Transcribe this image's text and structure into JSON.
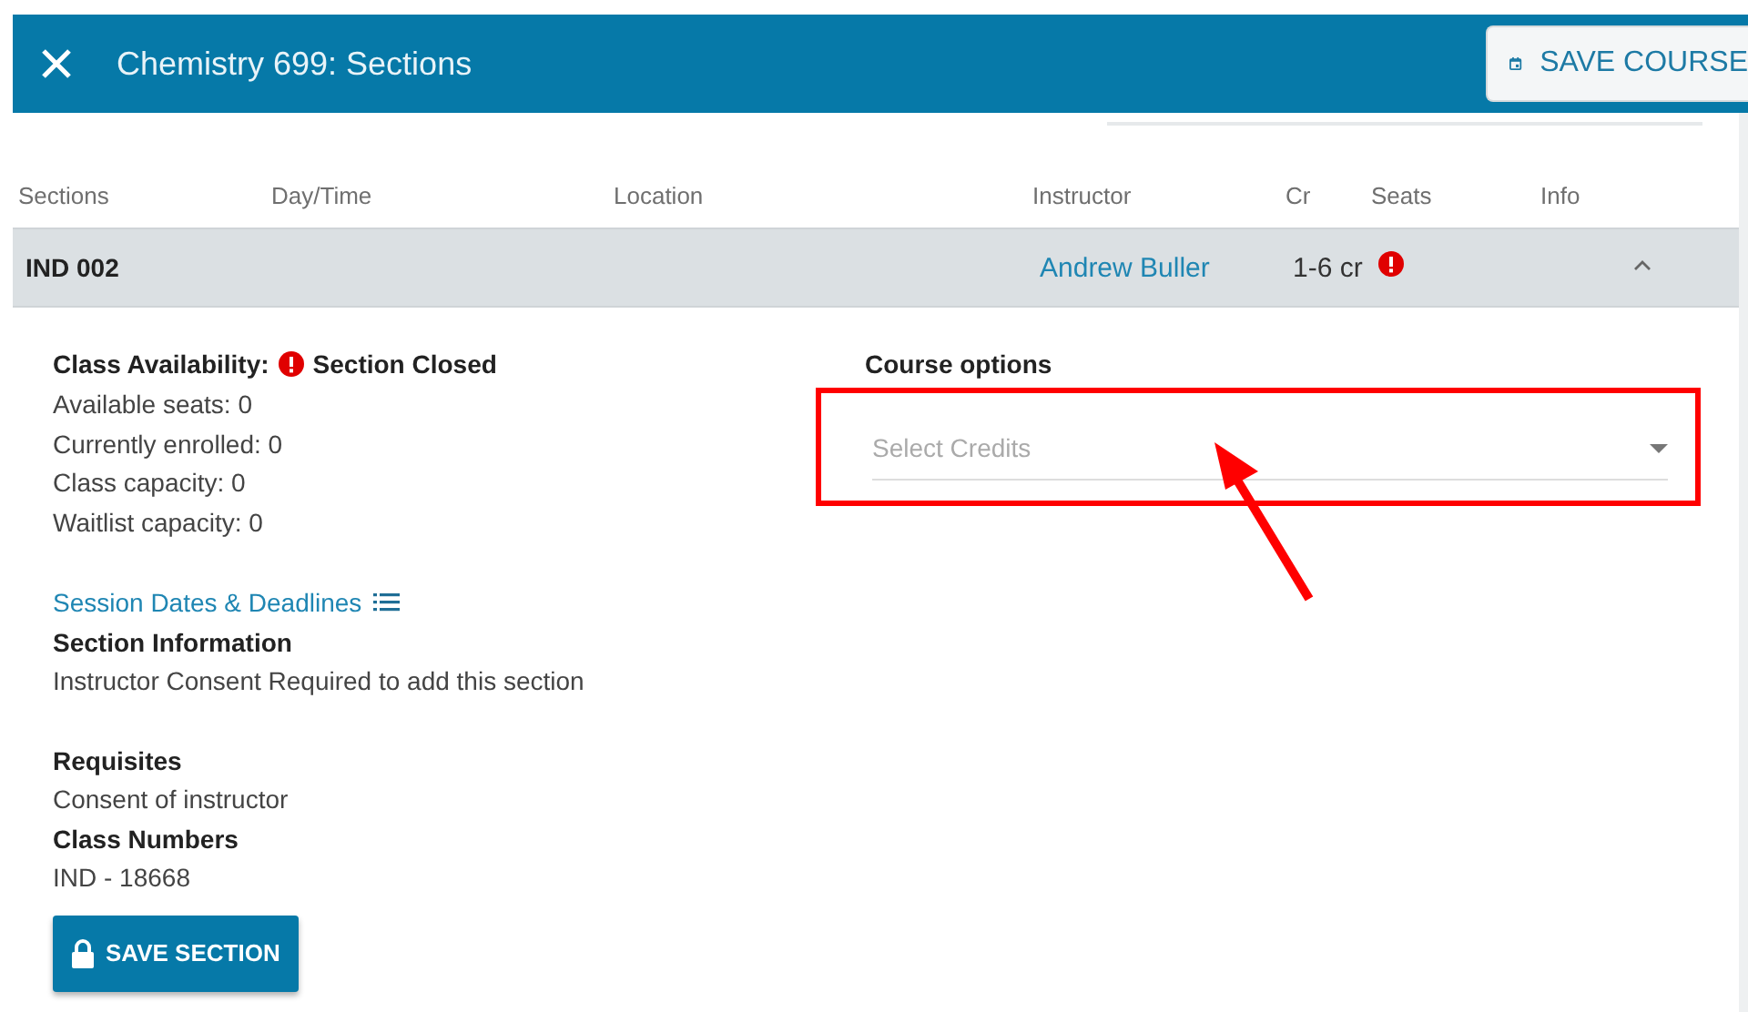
{
  "header": {
    "title": "Chemistry 699: Sections",
    "save_button": "SAVE COURSE"
  },
  "table": {
    "columns": [
      "Sections",
      "Day/Time",
      "Location",
      "Instructor",
      "Cr",
      "Seats",
      "Info"
    ],
    "rows": [
      {
        "section": "IND 002",
        "instructor": "Andrew Buller",
        "credits": "1-6 cr",
        "seats_alert": true,
        "expanded": true
      }
    ]
  },
  "details": {
    "availability_label": "Class Availability:",
    "availability_status": "Section Closed",
    "closed": true,
    "stats": [
      "Available seats: 0",
      "Currently enrolled: 0",
      "Class capacity: 0",
      "Waitlist capacity: 0"
    ],
    "dates_link": "Session Dates & Deadlines",
    "blocks": [
      {
        "heading": "Section Information",
        "text": "Instructor Consent Required to add this section"
      },
      {
        "heading": "Requisites",
        "text": "Consent of instructor"
      },
      {
        "heading": "Class Numbers",
        "text": "IND - 18668"
      }
    ],
    "save_button": "SAVE SECTION",
    "options_heading": "Course options",
    "credits_select": {
      "placeholder": "Select Credits"
    }
  },
  "annotation": {
    "highlight_box": true,
    "arrow": true
  }
}
